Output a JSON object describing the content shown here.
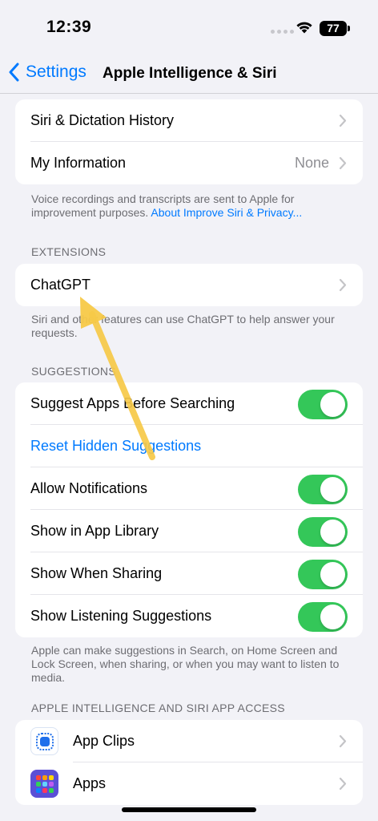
{
  "status_bar": {
    "time": "12:39",
    "battery": "77"
  },
  "nav": {
    "back_label": "Settings",
    "title": "Apple Intelligence & Siri"
  },
  "top_group": {
    "rows": [
      {
        "label": "Siri & Dictation History"
      },
      {
        "label": "My Information",
        "value": "None"
      }
    ]
  },
  "top_footnote": {
    "text": "Voice recordings and transcripts are sent to Apple for improvement purposes.",
    "link": "About Improve Siri & Privacy..."
  },
  "extensions": {
    "header": "EXTENSIONS",
    "rows": [
      {
        "label": "ChatGPT"
      }
    ],
    "footnote": "Siri and other features can use ChatGPT to help answer your requests."
  },
  "suggestions": {
    "header": "SUGGESTIONS",
    "rows": [
      {
        "label": "Suggest Apps Before Searching",
        "on": true
      },
      {
        "label": "Reset Hidden Suggestions"
      },
      {
        "label": "Allow Notifications",
        "on": true
      },
      {
        "label": "Show in App Library",
        "on": true
      },
      {
        "label": "Show When Sharing",
        "on": true
      },
      {
        "label": "Show Listening Suggestions",
        "on": true
      }
    ],
    "footnote": "Apple can make suggestions in Search, on Home Screen and Lock Screen, when sharing, or when you may want to listen to media."
  },
  "app_access": {
    "header": "APPLE INTELLIGENCE AND SIRI APP ACCESS",
    "rows": [
      {
        "label": "App Clips",
        "icon": "app-clips-icon"
      },
      {
        "label": "Apps",
        "icon": "apps-grid-icon"
      }
    ]
  },
  "colors": {
    "accent": "#007aff",
    "toggle_on": "#34c759",
    "annotation_arrow": "#f7c948",
    "background": "#f2f2f7"
  }
}
